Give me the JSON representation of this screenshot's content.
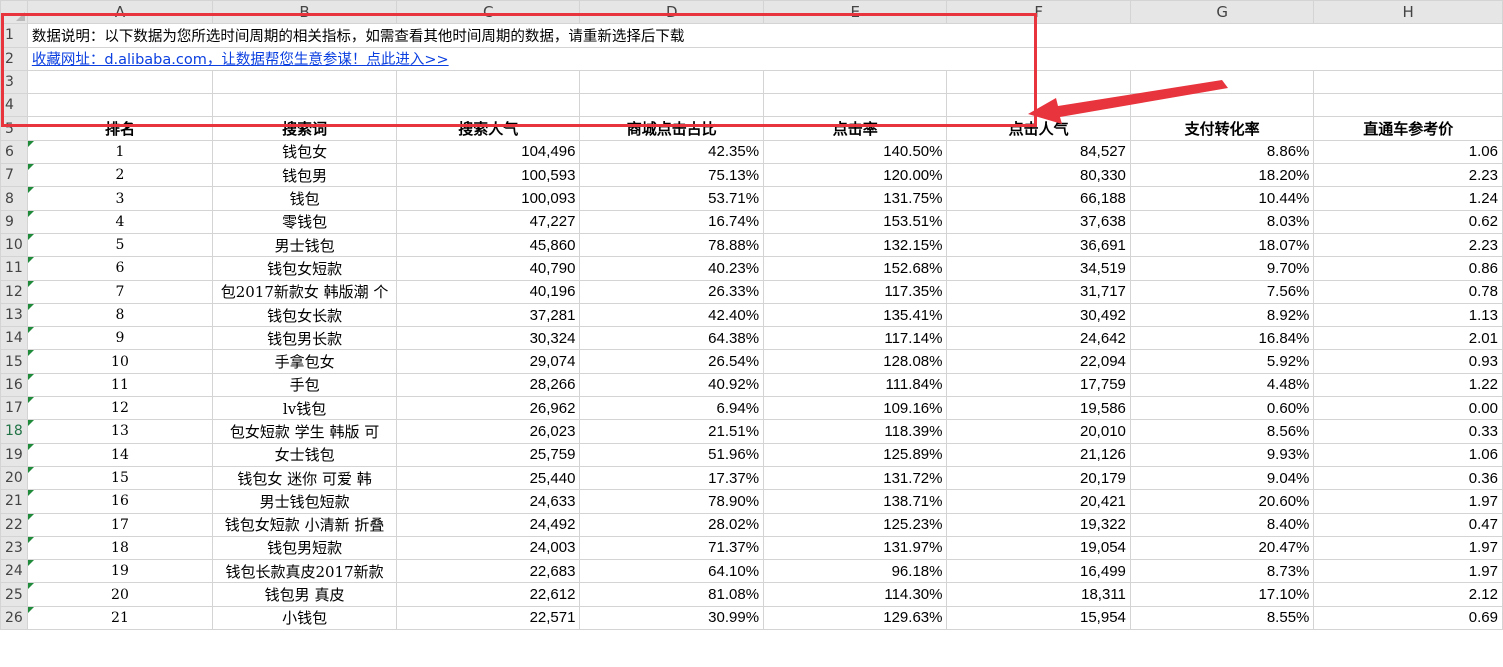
{
  "columns": [
    "A",
    "B",
    "C",
    "D",
    "E",
    "F",
    "G",
    "H"
  ],
  "row_numbers": [
    "1",
    "2",
    "3",
    "4",
    "5",
    "6",
    "7",
    "8",
    "9",
    "10",
    "11",
    "12",
    "13",
    "14",
    "15",
    "16",
    "17",
    "18",
    "19",
    "20",
    "21",
    "22",
    "23",
    "24",
    "25",
    "26"
  ],
  "selected_row": "18",
  "notice": {
    "row1": "数据说明：以下数据为您所选时间周期的相关指标，如需查看其他时间周期的数据，请重新选择后下载",
    "row2_link": "收藏网址：d.alibaba.com，让数据帮您生意参谋！点此进入>>"
  },
  "table": {
    "headers": [
      "排名",
      "搜索词",
      "搜索人气",
      "商城点击占比",
      "点击率",
      "点击人气",
      "支付转化率",
      "直通车参考价"
    ],
    "rows": [
      [
        "1",
        "钱包女",
        "104,496",
        "42.35%",
        "140.50%",
        "84,527",
        "8.86%",
        "1.06"
      ],
      [
        "2",
        "钱包男",
        "100,593",
        "75.13%",
        "120.00%",
        "80,330",
        "18.20%",
        "2.23"
      ],
      [
        "3",
        "钱包",
        "100,093",
        "53.71%",
        "131.75%",
        "66,188",
        "10.44%",
        "1.24"
      ],
      [
        "4",
        "零钱包",
        "47,227",
        "16.74%",
        "153.51%",
        "37,638",
        "8.03%",
        "0.62"
      ],
      [
        "5",
        "男士钱包",
        "45,860",
        "78.88%",
        "132.15%",
        "36,691",
        "18.07%",
        "2.23"
      ],
      [
        "6",
        "钱包女短款",
        "40,790",
        "40.23%",
        "152.68%",
        "34,519",
        "9.70%",
        "0.86"
      ],
      [
        "7",
        "包2017新款女 韩版潮 个",
        "40,196",
        "26.33%",
        "117.35%",
        "31,717",
        "7.56%",
        "0.78"
      ],
      [
        "8",
        "钱包女长款",
        "37,281",
        "42.40%",
        "135.41%",
        "30,492",
        "8.92%",
        "1.13"
      ],
      [
        "9",
        "钱包男长款",
        "30,324",
        "64.38%",
        "117.14%",
        "24,642",
        "16.84%",
        "2.01"
      ],
      [
        "10",
        "手拿包女",
        "29,074",
        "26.54%",
        "128.08%",
        "22,094",
        "5.92%",
        "0.93"
      ],
      [
        "11",
        "手包",
        "28,266",
        "40.92%",
        "111.84%",
        "17,759",
        "4.48%",
        "1.22"
      ],
      [
        "12",
        "lv钱包",
        "26,962",
        "6.94%",
        "109.16%",
        "19,586",
        "0.60%",
        "0.00"
      ],
      [
        "13",
        "包女短款 学生 韩版 可",
        "26,023",
        "21.51%",
        "118.39%",
        "20,010",
        "8.56%",
        "0.33"
      ],
      [
        "14",
        "女士钱包",
        "25,759",
        "51.96%",
        "125.89%",
        "21,126",
        "9.93%",
        "1.06"
      ],
      [
        "15",
        "钱包女 迷你 可爱 韩",
        "25,440",
        "17.37%",
        "131.72%",
        "20,179",
        "9.04%",
        "0.36"
      ],
      [
        "16",
        "男士钱包短款",
        "24,633",
        "78.90%",
        "138.71%",
        "20,421",
        "20.60%",
        "1.97"
      ],
      [
        "17",
        "钱包女短款 小清新 折叠",
        "24,492",
        "28.02%",
        "125.23%",
        "19,322",
        "8.40%",
        "0.47"
      ],
      [
        "18",
        "钱包男短款",
        "24,003",
        "71.37%",
        "131.97%",
        "19,054",
        "20.47%",
        "1.97"
      ],
      [
        "19",
        "钱包长款真皮2017新款",
        "22,683",
        "64.10%",
        "96.18%",
        "16,499",
        "8.73%",
        "1.97"
      ],
      [
        "20",
        "钱包男 真皮",
        "22,612",
        "81.08%",
        "114.30%",
        "18,311",
        "17.10%",
        "2.12"
      ],
      [
        "21",
        "小钱包",
        "22,571",
        "30.99%",
        "129.63%",
        "15,954",
        "8.55%",
        "0.69"
      ]
    ]
  },
  "colors": {
    "annotation": "#e8343d",
    "link": "#0b3fe0",
    "error_triangle": "#1e8a3a"
  }
}
